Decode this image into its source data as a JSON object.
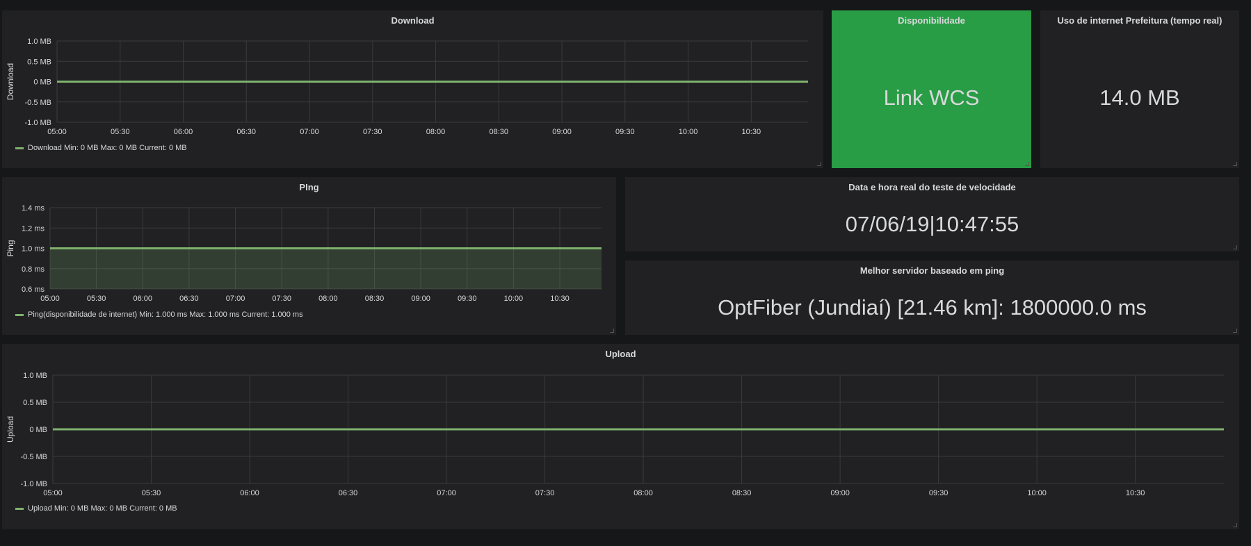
{
  "colors": {
    "background": "#161719",
    "panel": "#212124",
    "series": "#7eb26d",
    "availability_bg": "#299c46",
    "grid": "#3a3a3e",
    "text": "#d8d9da"
  },
  "download": {
    "title": "Download",
    "legend": "Download  Min: 0 MB  Max: 0 MB  Current: 0 MB",
    "chart_data": {
      "type": "line",
      "title": "Download",
      "ylabel": "Download",
      "x_ticks": [
        "05:00",
        "05:30",
        "06:00",
        "06:30",
        "07:00",
        "07:30",
        "08:00",
        "08:30",
        "09:00",
        "09:30",
        "10:00",
        "10:30"
      ],
      "y_ticks": [
        "1.0 MB",
        "0.5 MB",
        "0 MB",
        "-0.5 MB",
        "-1.0 MB"
      ],
      "ylim": [
        -1.0,
        1.0
      ],
      "series": [
        {
          "name": "Download",
          "x": [
            "05:00",
            "10:57"
          ],
          "values": [
            0,
            0
          ]
        }
      ]
    }
  },
  "availability": {
    "title": "Disponibilidade",
    "value": "Link WCS"
  },
  "usage": {
    "title": "Uso de internet Prefeitura (tempo real)",
    "value": "14.0 MB"
  },
  "ping": {
    "title": "PIng",
    "legend": "Ping(disponibilidade de internet)  Min: 1.000 ms  Max: 1.000 ms  Current: 1.000 ms",
    "chart_data": {
      "type": "area",
      "title": "PIng",
      "ylabel": "Ping",
      "x_ticks": [
        "05:00",
        "05:30",
        "06:00",
        "06:30",
        "07:00",
        "07:30",
        "08:00",
        "08:30",
        "09:00",
        "09:30",
        "10:00",
        "10:30"
      ],
      "y_ticks": [
        "1.4 ms",
        "1.2 ms",
        "1.0 ms",
        "0.8 ms",
        "0.6 ms"
      ],
      "ylim": [
        0.6,
        1.4
      ],
      "series": [
        {
          "name": "Ping(disponibilidade de internet)",
          "x": [
            "05:00",
            "10:57"
          ],
          "values": [
            1.0,
            1.0
          ]
        }
      ]
    }
  },
  "speedtest_time": {
    "title": "Data e hora real do teste de velocidade",
    "value": "07/06/19|10:47:55"
  },
  "best_server": {
    "title": "Melhor servidor baseado em ping",
    "value": "OptFiber (Jundiaí) [21.46 km]: 1800000.0 ms"
  },
  "upload": {
    "title": "Upload",
    "legend": "Upload  Min: 0 MB  Max: 0 MB  Current: 0 MB",
    "chart_data": {
      "type": "line",
      "title": "Upload",
      "ylabel": "Upload",
      "x_ticks": [
        "05:00",
        "05:30",
        "06:00",
        "06:30",
        "07:00",
        "07:30",
        "08:00",
        "08:30",
        "09:00",
        "09:30",
        "10:00",
        "10:30"
      ],
      "y_ticks": [
        "1.0 MB",
        "0.5 MB",
        "0 MB",
        "-0.5 MB",
        "-1.0 MB"
      ],
      "ylim": [
        -1.0,
        1.0
      ],
      "series": [
        {
          "name": "Upload",
          "x": [
            "05:00",
            "10:57"
          ],
          "values": [
            0,
            0
          ]
        }
      ]
    }
  }
}
